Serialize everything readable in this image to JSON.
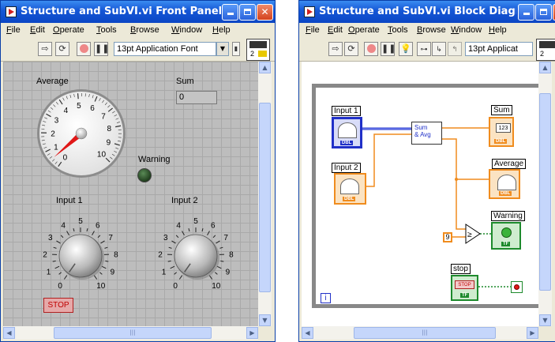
{
  "front_panel": {
    "title": "Structure and SubVI.vi Front Panel",
    "menu": [
      {
        "label": "File",
        "u": "F",
        "rest": "ile"
      },
      {
        "label": "Edit",
        "u": "E",
        "rest": "dit"
      },
      {
        "label": "Operate",
        "u": "O",
        "rest": "perate"
      },
      {
        "label": "Tools",
        "u": "T",
        "rest": "ools"
      },
      {
        "label": "Browse",
        "u": "B",
        "rest": "rowse"
      },
      {
        "label": "Window",
        "u": "W",
        "rest": "indow"
      },
      {
        "label": "Help",
        "u": "H",
        "rest": "elp"
      }
    ],
    "font_select": "13pt Application Font",
    "connector_number": "2",
    "average": {
      "label": "Average",
      "ticks": [
        "0",
        "1",
        "2",
        "3",
        "4",
        "5",
        "6",
        "7",
        "8",
        "9",
        "10"
      ],
      "value": 0.5
    },
    "sum": {
      "label": "Sum",
      "value": "0"
    },
    "warning": {
      "label": "Warning",
      "state": false
    },
    "input1": {
      "label": "Input 1",
      "ticks": [
        "0",
        "1",
        "2",
        "3",
        "4",
        "5",
        "6",
        "7",
        "8",
        "9",
        "10"
      ]
    },
    "input2": {
      "label": "Input 2",
      "ticks": [
        "0",
        "1",
        "2",
        "3",
        "4",
        "5",
        "6",
        "7",
        "8",
        "9",
        "10"
      ]
    },
    "stop": {
      "label": "STOP"
    }
  },
  "block_diagram": {
    "title": "Structure and SubVI.vi Block Diagram",
    "menu": [
      {
        "label": "File",
        "u": "F",
        "rest": "ile"
      },
      {
        "label": "Edit",
        "u": "E",
        "rest": "dit"
      },
      {
        "label": "Operate",
        "u": "O",
        "rest": "perate"
      },
      {
        "label": "Tools",
        "u": "T",
        "rest": "ools"
      },
      {
        "label": "Browse",
        "u": "B",
        "rest": "rowse"
      },
      {
        "label": "Window",
        "u": "W",
        "rest": "indow"
      },
      {
        "label": "Help",
        "u": "H",
        "rest": "elp"
      }
    ],
    "font_select": "13pt Applicat",
    "connector_number": "2",
    "input1_label": "Input 1",
    "input2_label": "Input 2",
    "subvi_label": "Sum\n& Avg",
    "sum_label": "Sum",
    "sum_type": "123",
    "average_label": "Average",
    "warning_label": "Warning",
    "stop_label": "stop",
    "stop_icon_text": "STOP",
    "constant": "9",
    "dbl_tag": "DBL",
    "tf_tag": "TF",
    "loop_iter": "i"
  },
  "colors": {
    "title_blue": "#1556d6",
    "numeric_orange": "#f08c1e",
    "boolean_green": "#1d8a2c",
    "wire_blue": "#2030c8",
    "grid_gray": "#bdbdbd"
  }
}
